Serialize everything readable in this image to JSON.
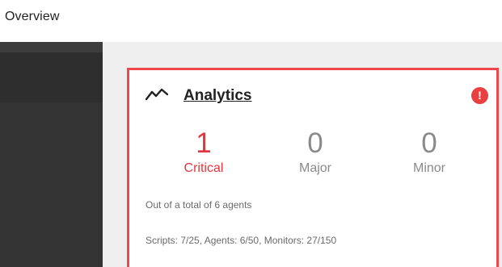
{
  "header": {
    "title": "Overview"
  },
  "card": {
    "title": "Analytics",
    "title_icon": "trend-line-icon",
    "alert_icon": "exclamation-icon",
    "alert_symbol": "!",
    "metrics": [
      {
        "value": "1",
        "label": "Critical"
      },
      {
        "value": "0",
        "label": "Major"
      },
      {
        "value": "0",
        "label": "Minor"
      }
    ],
    "agents_summary": "Out of a total of 6 agents",
    "resources_summary": "Scripts: 7/25, Agents: 6/50, Monitors: 27/150"
  },
  "colors": {
    "accent_red": "#f0474d",
    "critical_text": "#e5353c",
    "muted_text": "#8a8a8a",
    "sidebar_dark": "#333333",
    "content_background": "#efefef"
  }
}
